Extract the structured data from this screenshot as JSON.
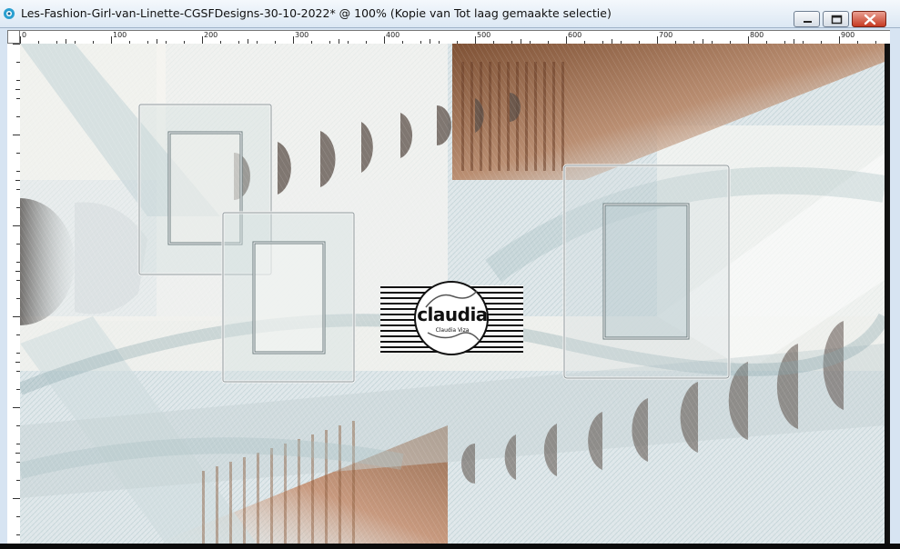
{
  "window": {
    "title": "Les-Fashion-Girl-van-Linette-CGSFDesigns-30-10-2022* @ 100% (Kopie van Tot laag gemaakte selectie)",
    "buttons": {
      "minimize": "minimize-icon",
      "maximize": "maximize-icon",
      "close": "close-icon"
    }
  },
  "ruler": {
    "horizontal_labels": [
      "0",
      "100",
      "200",
      "300",
      "400",
      "500",
      "600",
      "700",
      "800",
      "900"
    ]
  },
  "canvas": {
    "watermark": {
      "text": "claudia",
      "sub": "Claudia Viza"
    }
  },
  "colors": {
    "teal": "#8fb3b8",
    "brown": "#8b5a3e",
    "cream": "#f4f2ec"
  }
}
